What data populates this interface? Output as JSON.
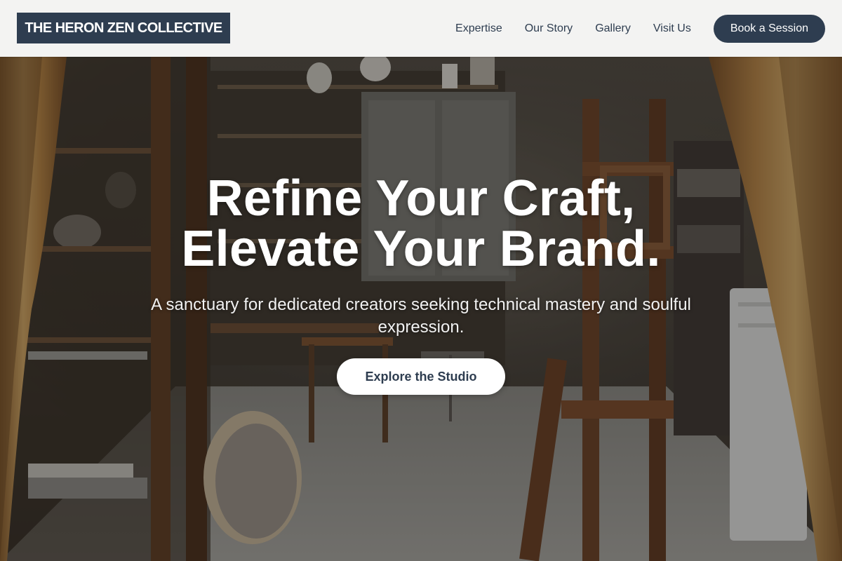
{
  "brand": {
    "name": "THE HERON ZEN COLLECTIVE"
  },
  "nav": {
    "links": [
      {
        "label": "Expertise"
      },
      {
        "label": "Our Story"
      },
      {
        "label": "Gallery"
      },
      {
        "label": "Visit Us"
      }
    ],
    "cta_label": "Book a Session"
  },
  "hero": {
    "title_line_1": "Refine Your Craft,",
    "title_line_2": "Elevate Your Brand.",
    "subtitle": "A sanctuary for dedicated creators seeking technical mastery and soulful expression.",
    "button_label": "Explore the Studio",
    "image_subject": "artist studio interior with wooden easels, shelves of ceramics and curtains"
  },
  "colors": {
    "brand_navy": "#2e3d50",
    "header_bg": "#f3f3f2",
    "hero_text": "#ffffff",
    "wood": "#6b3f22",
    "curtain": "#c99a52"
  }
}
